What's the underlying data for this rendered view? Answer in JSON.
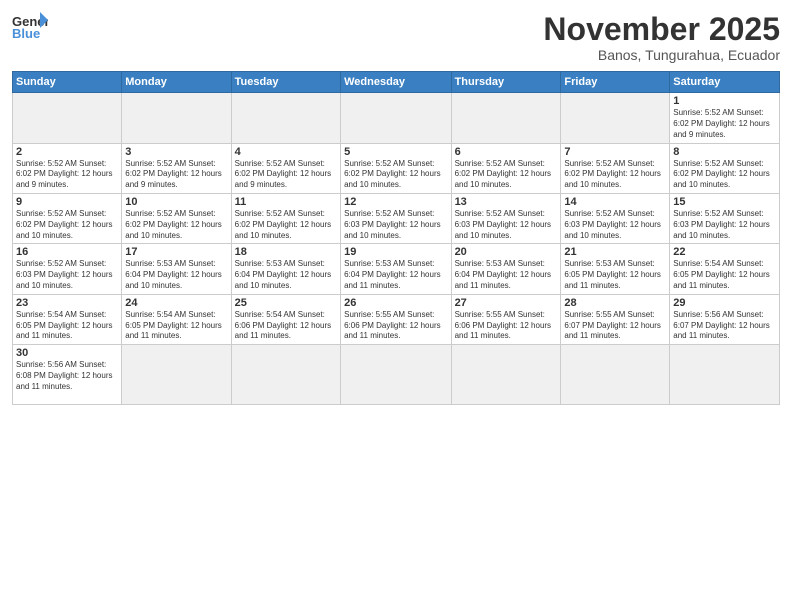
{
  "logo": {
    "general": "General",
    "blue": "Blue"
  },
  "title": "November 2025",
  "subtitle": "Banos, Tungurahua, Ecuador",
  "days_header": [
    "Sunday",
    "Monday",
    "Tuesday",
    "Wednesday",
    "Thursday",
    "Friday",
    "Saturday"
  ],
  "weeks": [
    [
      {
        "day": "",
        "empty": true
      },
      {
        "day": "",
        "empty": true
      },
      {
        "day": "",
        "empty": true
      },
      {
        "day": "",
        "empty": true
      },
      {
        "day": "",
        "empty": true
      },
      {
        "day": "",
        "empty": true
      },
      {
        "day": "1",
        "info": "Sunrise: 5:52 AM\nSunset: 6:02 PM\nDaylight: 12 hours\nand 9 minutes."
      }
    ],
    [
      {
        "day": "2",
        "info": "Sunrise: 5:52 AM\nSunset: 6:02 PM\nDaylight: 12 hours\nand 9 minutes."
      },
      {
        "day": "3",
        "info": "Sunrise: 5:52 AM\nSunset: 6:02 PM\nDaylight: 12 hours\nand 9 minutes."
      },
      {
        "day": "4",
        "info": "Sunrise: 5:52 AM\nSunset: 6:02 PM\nDaylight: 12 hours\nand 9 minutes."
      },
      {
        "day": "5",
        "info": "Sunrise: 5:52 AM\nSunset: 6:02 PM\nDaylight: 12 hours\nand 10 minutes."
      },
      {
        "day": "6",
        "info": "Sunrise: 5:52 AM\nSunset: 6:02 PM\nDaylight: 12 hours\nand 10 minutes."
      },
      {
        "day": "7",
        "info": "Sunrise: 5:52 AM\nSunset: 6:02 PM\nDaylight: 12 hours\nand 10 minutes."
      },
      {
        "day": "8",
        "info": "Sunrise: 5:52 AM\nSunset: 6:02 PM\nDaylight: 12 hours\nand 10 minutes."
      }
    ],
    [
      {
        "day": "9",
        "info": "Sunrise: 5:52 AM\nSunset: 6:02 PM\nDaylight: 12 hours\nand 10 minutes."
      },
      {
        "day": "10",
        "info": "Sunrise: 5:52 AM\nSunset: 6:02 PM\nDaylight: 12 hours\nand 10 minutes."
      },
      {
        "day": "11",
        "info": "Sunrise: 5:52 AM\nSunset: 6:02 PM\nDaylight: 12 hours\nand 10 minutes."
      },
      {
        "day": "12",
        "info": "Sunrise: 5:52 AM\nSunset: 6:03 PM\nDaylight: 12 hours\nand 10 minutes."
      },
      {
        "day": "13",
        "info": "Sunrise: 5:52 AM\nSunset: 6:03 PM\nDaylight: 12 hours\nand 10 minutes."
      },
      {
        "day": "14",
        "info": "Sunrise: 5:52 AM\nSunset: 6:03 PM\nDaylight: 12 hours\nand 10 minutes."
      },
      {
        "day": "15",
        "info": "Sunrise: 5:52 AM\nSunset: 6:03 PM\nDaylight: 12 hours\nand 10 minutes."
      }
    ],
    [
      {
        "day": "16",
        "info": "Sunrise: 5:52 AM\nSunset: 6:03 PM\nDaylight: 12 hours\nand 10 minutes."
      },
      {
        "day": "17",
        "info": "Sunrise: 5:53 AM\nSunset: 6:04 PM\nDaylight: 12 hours\nand 10 minutes."
      },
      {
        "day": "18",
        "info": "Sunrise: 5:53 AM\nSunset: 6:04 PM\nDaylight: 12 hours\nand 10 minutes."
      },
      {
        "day": "19",
        "info": "Sunrise: 5:53 AM\nSunset: 6:04 PM\nDaylight: 12 hours\nand 11 minutes."
      },
      {
        "day": "20",
        "info": "Sunrise: 5:53 AM\nSunset: 6:04 PM\nDaylight: 12 hours\nand 11 minutes."
      },
      {
        "day": "21",
        "info": "Sunrise: 5:53 AM\nSunset: 6:05 PM\nDaylight: 12 hours\nand 11 minutes."
      },
      {
        "day": "22",
        "info": "Sunrise: 5:54 AM\nSunset: 6:05 PM\nDaylight: 12 hours\nand 11 minutes."
      }
    ],
    [
      {
        "day": "23",
        "info": "Sunrise: 5:54 AM\nSunset: 6:05 PM\nDaylight: 12 hours\nand 11 minutes."
      },
      {
        "day": "24",
        "info": "Sunrise: 5:54 AM\nSunset: 6:05 PM\nDaylight: 12 hours\nand 11 minutes."
      },
      {
        "day": "25",
        "info": "Sunrise: 5:54 AM\nSunset: 6:06 PM\nDaylight: 12 hours\nand 11 minutes."
      },
      {
        "day": "26",
        "info": "Sunrise: 5:55 AM\nSunset: 6:06 PM\nDaylight: 12 hours\nand 11 minutes."
      },
      {
        "day": "27",
        "info": "Sunrise: 5:55 AM\nSunset: 6:06 PM\nDaylight: 12 hours\nand 11 minutes."
      },
      {
        "day": "28",
        "info": "Sunrise: 5:55 AM\nSunset: 6:07 PM\nDaylight: 12 hours\nand 11 minutes."
      },
      {
        "day": "29",
        "info": "Sunrise: 5:56 AM\nSunset: 6:07 PM\nDaylight: 12 hours\nand 11 minutes."
      }
    ],
    [
      {
        "day": "30",
        "info": "Sunrise: 5:56 AM\nSunset: 6:08 PM\nDaylight: 12 hours\nand 11 minutes."
      },
      {
        "day": "",
        "empty": true
      },
      {
        "day": "",
        "empty": true
      },
      {
        "day": "",
        "empty": true
      },
      {
        "day": "",
        "empty": true
      },
      {
        "day": "",
        "empty": true
      },
      {
        "day": "",
        "empty": true
      }
    ]
  ]
}
